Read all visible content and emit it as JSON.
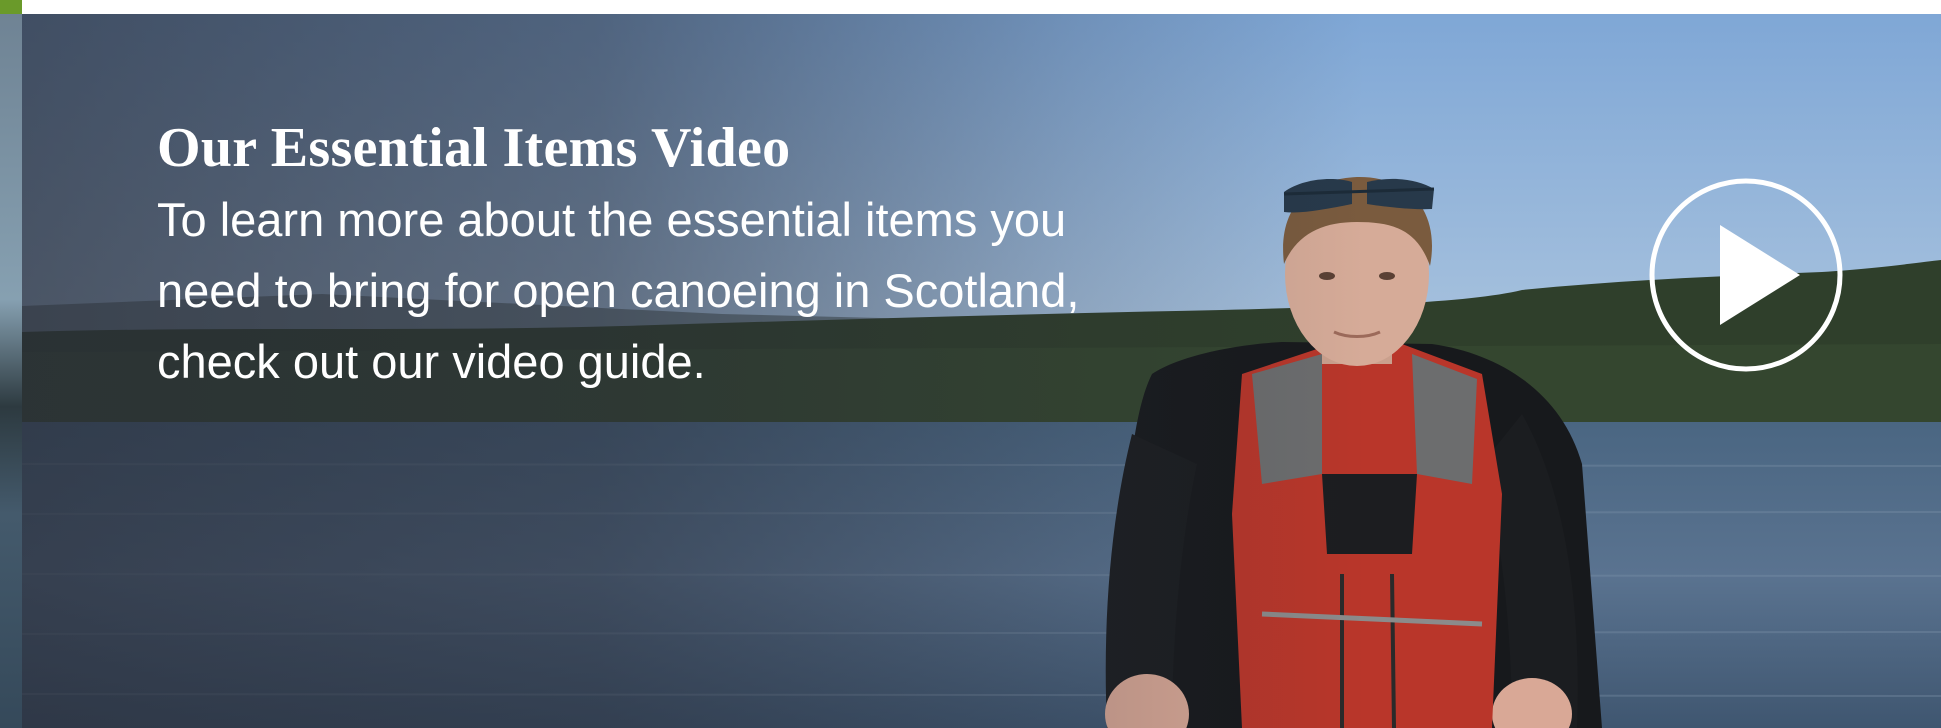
{
  "hero": {
    "title": "Our Essential Items Video",
    "description": "To learn more about the essential items you need to bring for open canoeing in Scotland, check out our video guide.",
    "play_icon": "play-circle-icon"
  },
  "colors": {
    "accent": "#6a9a2a",
    "text": "#ffffff",
    "sky": "#8fb0d6",
    "water": "#4c6580",
    "forest": "#2e3d2a",
    "buoyancy_aid": "#b9362a"
  }
}
